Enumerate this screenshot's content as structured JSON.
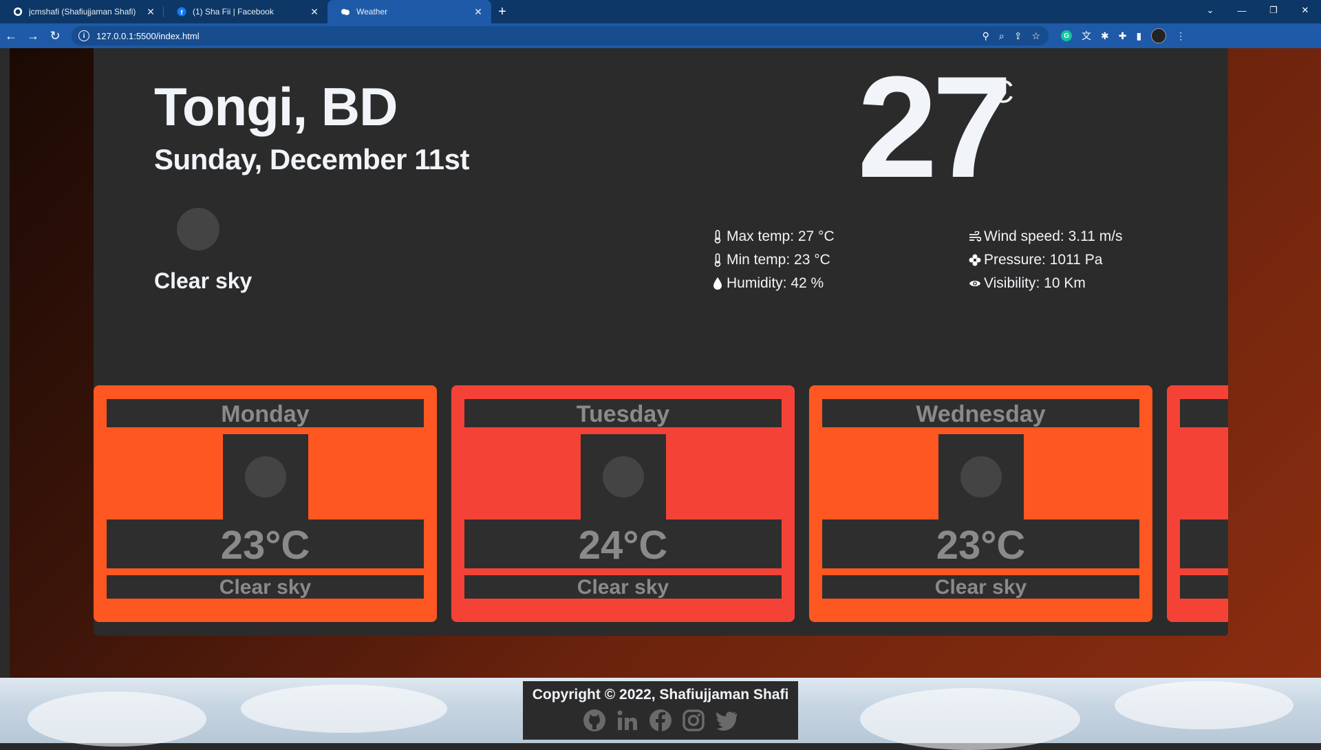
{
  "browser": {
    "tabs": [
      {
        "title": "jcmshafi (Shafiujjaman Shafi)",
        "icon": "github-icon"
      },
      {
        "title": "(1) Sha Fii | Facebook",
        "icon": "facebook-icon"
      },
      {
        "title": "Weather",
        "icon": "weather-icon",
        "active": true
      }
    ],
    "url": "127.0.0.1:5500/index.html"
  },
  "current": {
    "city": "Tongi, BD",
    "date": "Sunday, December 11st",
    "description": "Clear sky",
    "temperature": "27",
    "unit": "°C",
    "stats": {
      "max_temp": "Max temp: 27 °C",
      "min_temp": "Min temp: 23 °C",
      "humidity": "Humidity: 42 %",
      "wind": "Wind speed: 3.11 m/s",
      "pressure": "Pressure: 1011 Pa",
      "visibility": "Visibility: 10 Km"
    }
  },
  "forecast": [
    {
      "day": "Monday",
      "temp": "23°C",
      "desc": "Clear sky",
      "color": "#ff5722"
    },
    {
      "day": "Tuesday",
      "temp": "24°C",
      "desc": "Clear sky",
      "color": "#f44336"
    },
    {
      "day": "Wednesday",
      "temp": "23°C",
      "desc": "Clear sky",
      "color": "#ff5722"
    },
    {
      "day": "",
      "temp": "",
      "desc": "",
      "color": "#f44336"
    }
  ],
  "footer": {
    "copyright": "Copyright © 2022, Shafiujjaman Shafi",
    "socials": [
      "github-icon",
      "linkedin-icon",
      "facebook-icon",
      "instagram-icon",
      "twitter-icon"
    ]
  }
}
